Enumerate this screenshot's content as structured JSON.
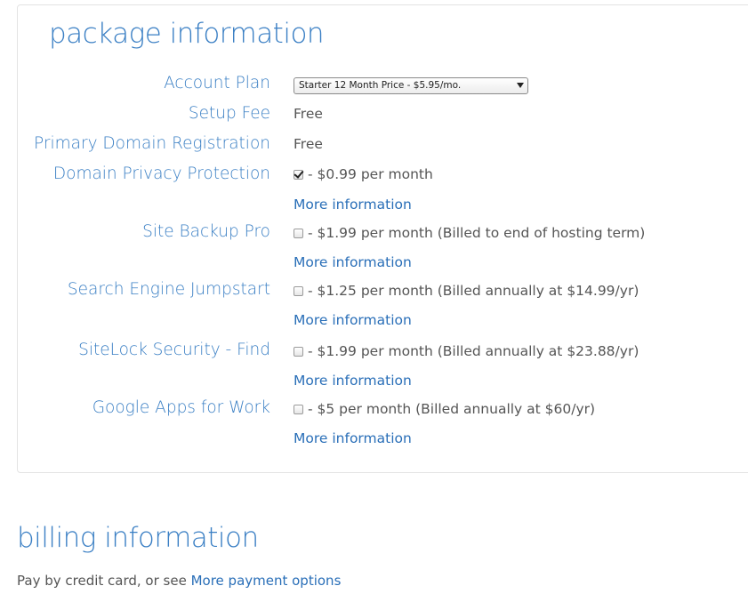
{
  "package": {
    "title": "package information",
    "account_plan": {
      "label": "Account Plan",
      "selected": "Starter 12 Month Price - $5.95/mo."
    },
    "setup_fee": {
      "label": "Setup Fee",
      "value": "Free"
    },
    "primary_domain": {
      "label": "Primary Domain Registration",
      "value": "Free"
    },
    "addons": [
      {
        "label": "Domain Privacy Protection",
        "checked": true,
        "price_text": "- $0.99 per month",
        "more_link": "More information"
      },
      {
        "label": "Site Backup Pro",
        "checked": false,
        "price_text": "- $1.99 per month (Billed to end of hosting term)",
        "more_link": "More information"
      },
      {
        "label": "Search Engine Jumpstart",
        "checked": false,
        "price_text": "- $1.25 per month (Billed annually at $14.99/yr)",
        "more_link": "More information"
      },
      {
        "label": "SiteLock Security - Find",
        "checked": false,
        "price_text": "- $1.99 per month (Billed annually at $23.88/yr)",
        "more_link": "More information"
      },
      {
        "label": "Google Apps for Work",
        "checked": false,
        "price_text": "- $5 per month (Billed annually at $60/yr)",
        "more_link": "More information"
      }
    ]
  },
  "billing": {
    "title": "billing information",
    "text": "Pay by credit card, or see ",
    "link": "More payment options"
  },
  "colors": {
    "label_blue": "#3a7fc4",
    "link_blue": "#2a6fb8",
    "text_gray": "#555555",
    "panel_border": "#e3e3e3"
  }
}
